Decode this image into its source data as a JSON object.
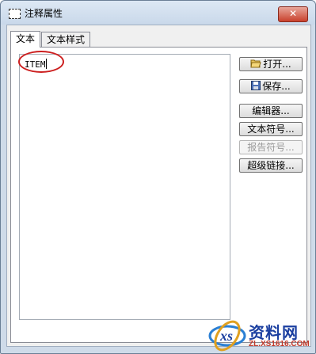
{
  "window": {
    "title": "注释属性",
    "close_label": "✕"
  },
  "tabs": [
    {
      "label": "文本",
      "active": true
    },
    {
      "label": "文本样式",
      "active": false
    }
  ],
  "editor": {
    "value": "ITEM"
  },
  "buttons": {
    "open": "打开...",
    "save": "保存...",
    "editor": "编辑器...",
    "text_symbol": "文本符号...",
    "report_symbol": "报告符号...",
    "hyperlink": "超级链接..."
  },
  "watermark": {
    "brand_cn": "资料网",
    "url": "ZL.XS1616.COM"
  },
  "colors": {
    "callout": "#cc1f1f",
    "close_button": "#c9412d"
  }
}
